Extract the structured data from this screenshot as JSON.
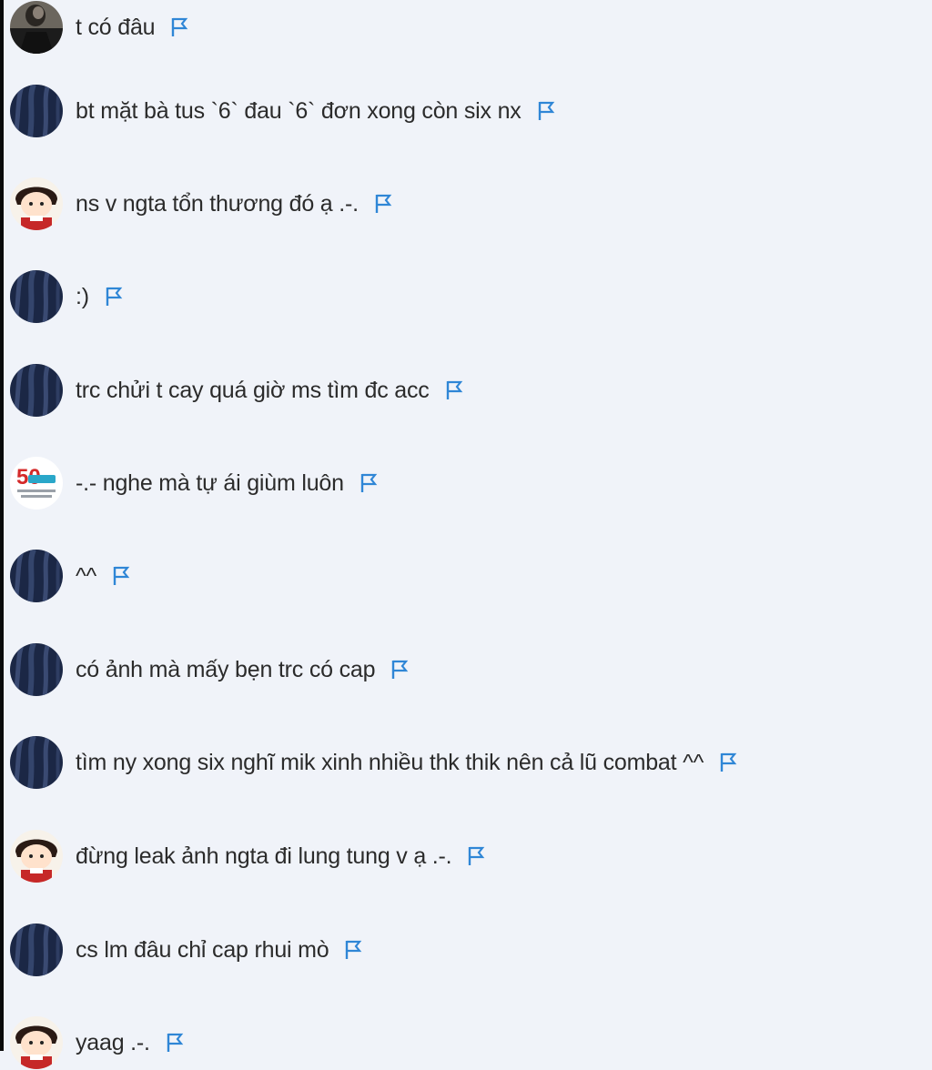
{
  "messages": [
    {
      "text": "t có đâu",
      "avatar": "dark-person"
    },
    {
      "text": "bt mặt bà tus `6` đau `6` đơn xong còn six nx",
      "avatar": "navy-fabric"
    },
    {
      "text": "ns v ngta tổn thương đó ạ .-.",
      "avatar": "cartoon-girl"
    },
    {
      "text": ":)",
      "avatar": "navy-fabric"
    },
    {
      "text": "trc chửi t cay quá giờ ms tìm đc acc",
      "avatar": "navy-fabric"
    },
    {
      "text": "-.- nghe mà tự ái giùm luôn",
      "avatar": "logo-50"
    },
    {
      "text": "^^",
      "avatar": "navy-fabric"
    },
    {
      "text": "có ảnh mà mấy bẹn trc có cap",
      "avatar": "navy-fabric"
    },
    {
      "text": "tìm ny xong six nghĩ mik xinh nhiều thk thik nên cả lũ combat ^^",
      "avatar": "navy-fabric"
    },
    {
      "text": "đừng leak ảnh ngta đi lung tung v ạ .-.",
      "avatar": "cartoon-girl"
    },
    {
      "text": "cs lm đâu chỉ cap rhui mò",
      "avatar": "navy-fabric"
    },
    {
      "text": "yaag .-.",
      "avatar": "cartoon-girl"
    }
  ],
  "icons": {
    "flag": "flag-icon"
  },
  "colors": {
    "background": "#f0f3f9",
    "text": "#2b2b2b",
    "flag": "#2f86d6"
  },
  "logo_text": "50"
}
